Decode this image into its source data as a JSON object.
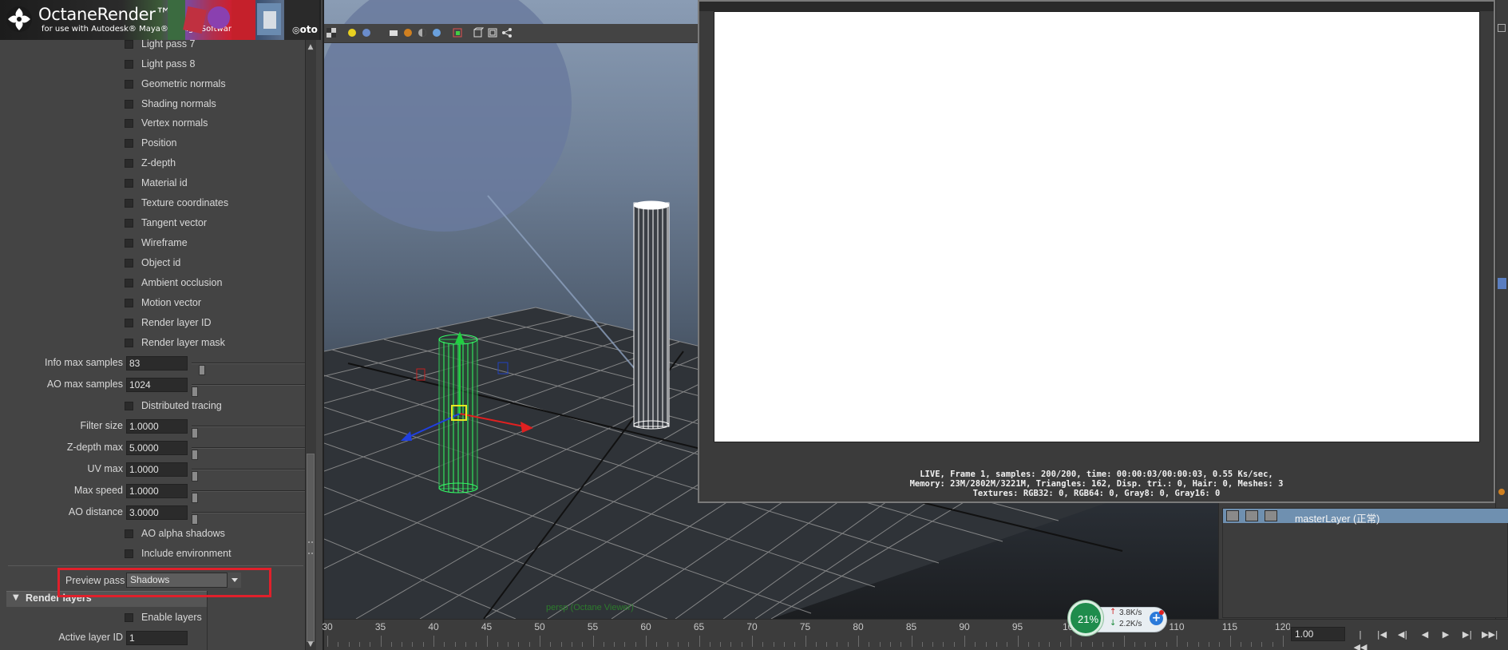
{
  "banner": {
    "title": "OctaneRender™",
    "subtitle": "for use with Autodesk® Maya® Design Software",
    "corner_text": "oto"
  },
  "passes": [
    {
      "label": "Light pass 7"
    },
    {
      "label": "Light pass 8"
    },
    {
      "label": "Geometric normals"
    },
    {
      "label": "Shading normals"
    },
    {
      "label": "Vertex normals"
    },
    {
      "label": "Position"
    },
    {
      "label": "Z-depth"
    },
    {
      "label": "Material id"
    },
    {
      "label": "Texture coordinates"
    },
    {
      "label": "Tangent vector"
    },
    {
      "label": "Wireframe"
    },
    {
      "label": "Object id"
    },
    {
      "label": "Ambient occlusion"
    },
    {
      "label": "Motion vector"
    },
    {
      "label": "Render layer ID"
    },
    {
      "label": "Render layer mask"
    }
  ],
  "info_max_samples": {
    "label": "Info max samples",
    "value": "83"
  },
  "ao_max_samples": {
    "label": "AO max samples",
    "value": "1024"
  },
  "distributed_tracing": {
    "label": "Distributed tracing"
  },
  "filter_size": {
    "label": "Filter size",
    "value": "1.0000"
  },
  "zdepth_max": {
    "label": "Z-depth max",
    "value": "5.0000"
  },
  "uv_max": {
    "label": "UV max",
    "value": "1.0000"
  },
  "max_speed": {
    "label": "Max speed",
    "value": "1.0000"
  },
  "ao_distance": {
    "label": "AO distance",
    "value": "3.0000"
  },
  "ao_alpha_shadows": {
    "label": "AO alpha shadows"
  },
  "include_environment": {
    "label": "Include environment"
  },
  "preview_pass": {
    "label": "Preview pass",
    "value": "Shadows"
  },
  "render_layers": {
    "title": "Render layers",
    "enable_layers": "Enable layers",
    "active_layer_label": "Active layer ID",
    "active_layer_value": "1"
  },
  "viewport": {
    "camera_label": "persp (Octane Viewer)"
  },
  "render_view": {
    "stats": [
      "LIVE, Frame 1, samples: 200/200, time: 00:00:03/00:00:03, 0.55 Ks/sec,",
      "Memory: 23M/2802M/3221M, Triangles: 162, Disp. tri.: 0, Hair: 0, Meshes: 3",
      "Textures: RGB32: 0, RGB64: 0, Gray8: 0, Gray16: 0"
    ]
  },
  "layer_editor": {
    "layer_name": "masterLayer (正常)"
  },
  "timeline": {
    "ticks": [
      "30",
      "35",
      "40",
      "45",
      "50",
      "55",
      "60",
      "65",
      "70",
      "75",
      "80",
      "85",
      "90",
      "95",
      "100",
      "105",
      "110",
      "115",
      "120"
    ],
    "current_frame": "1.00",
    "buttons": [
      "go-to-start",
      "step-back-key",
      "step-back-frame",
      "play-backwards",
      "play-forwards",
      "step-forward-key",
      "go-to-end"
    ]
  },
  "network_widget": {
    "percent": "21%",
    "upload": "3.8K/s",
    "download": "2.2K/s"
  },
  "colors": {
    "highlight_box": "#e0202b",
    "selected_layer": "#6f90b0",
    "wireframe_selected": "#33ff66",
    "render_background": "#ffffff"
  }
}
